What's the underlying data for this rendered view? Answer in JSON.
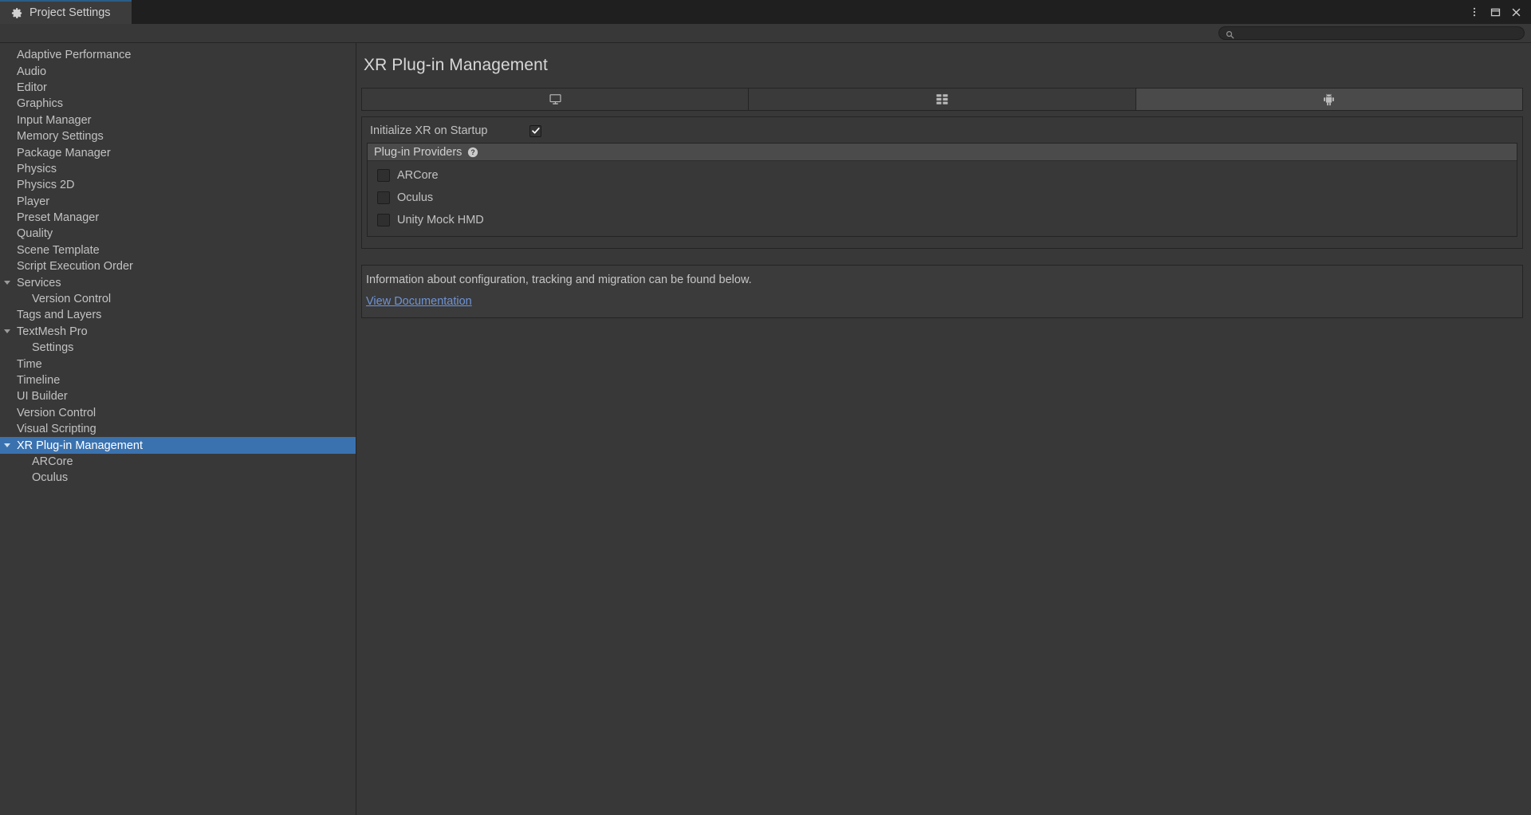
{
  "window": {
    "tab_title": "Project Settings",
    "tab_icon": "gear-icon",
    "controls": {
      "menu_icon": "kebab-menu-icon",
      "maximize_icon": "maximize-icon",
      "close_icon": "close-icon"
    }
  },
  "search": {
    "icon": "search-icon",
    "value": "",
    "placeholder": ""
  },
  "sidebar": {
    "items": [
      {
        "label": "Adaptive Performance",
        "depth": 0,
        "expandable": false,
        "selected": false
      },
      {
        "label": "Audio",
        "depth": 0,
        "expandable": false,
        "selected": false
      },
      {
        "label": "Editor",
        "depth": 0,
        "expandable": false,
        "selected": false
      },
      {
        "label": "Graphics",
        "depth": 0,
        "expandable": false,
        "selected": false
      },
      {
        "label": "Input Manager",
        "depth": 0,
        "expandable": false,
        "selected": false
      },
      {
        "label": "Memory Settings",
        "depth": 0,
        "expandable": false,
        "selected": false
      },
      {
        "label": "Package Manager",
        "depth": 0,
        "expandable": false,
        "selected": false
      },
      {
        "label": "Physics",
        "depth": 0,
        "expandable": false,
        "selected": false
      },
      {
        "label": "Physics 2D",
        "depth": 0,
        "expandable": false,
        "selected": false
      },
      {
        "label": "Player",
        "depth": 0,
        "expandable": false,
        "selected": false
      },
      {
        "label": "Preset Manager",
        "depth": 0,
        "expandable": false,
        "selected": false
      },
      {
        "label": "Quality",
        "depth": 0,
        "expandable": false,
        "selected": false
      },
      {
        "label": "Scene Template",
        "depth": 0,
        "expandable": false,
        "selected": false
      },
      {
        "label": "Script Execution Order",
        "depth": 0,
        "expandable": false,
        "selected": false
      },
      {
        "label": "Services",
        "depth": 0,
        "expandable": true,
        "selected": false
      },
      {
        "label": "Version Control",
        "depth": 1,
        "expandable": false,
        "selected": false
      },
      {
        "label": "Tags and Layers",
        "depth": 0,
        "expandable": false,
        "selected": false
      },
      {
        "label": "TextMesh Pro",
        "depth": 0,
        "expandable": true,
        "selected": false
      },
      {
        "label": "Settings",
        "depth": 1,
        "expandable": false,
        "selected": false
      },
      {
        "label": "Time",
        "depth": 0,
        "expandable": false,
        "selected": false
      },
      {
        "label": "Timeline",
        "depth": 0,
        "expandable": false,
        "selected": false
      },
      {
        "label": "UI Builder",
        "depth": 0,
        "expandable": false,
        "selected": false
      },
      {
        "label": "Version Control",
        "depth": 0,
        "expandable": false,
        "selected": false
      },
      {
        "label": "Visual Scripting",
        "depth": 0,
        "expandable": false,
        "selected": false
      },
      {
        "label": "XR Plug-in Management",
        "depth": 0,
        "expandable": true,
        "selected": true
      },
      {
        "label": "ARCore",
        "depth": 1,
        "expandable": false,
        "selected": false
      },
      {
        "label": "Oculus",
        "depth": 1,
        "expandable": false,
        "selected": false
      }
    ],
    "selected_color": "#3a72b0"
  },
  "main": {
    "title": "XR Plug-in Management",
    "platform_tabs": [
      {
        "icon": "desktop-monitor-icon",
        "name": "standalone",
        "active": false
      },
      {
        "icon": "uwp-blocks-icon",
        "name": "universal-windows-platform",
        "active": false
      },
      {
        "icon": "android-robot-icon",
        "name": "android",
        "active": true
      }
    ],
    "initialize_xr": {
      "label": "Initialize XR on Startup",
      "checked": true
    },
    "providers_section": {
      "header": "Plug-in Providers",
      "help_icon": "help-circle-icon",
      "items": [
        {
          "label": "ARCore",
          "checked": false
        },
        {
          "label": "Oculus",
          "checked": false
        },
        {
          "label": "Unity Mock HMD",
          "checked": false
        }
      ]
    },
    "info": {
      "text": "Information about configuration, tracking and migration can be found below.",
      "link_label": "View Documentation",
      "link_color": "#6f93d6"
    }
  }
}
